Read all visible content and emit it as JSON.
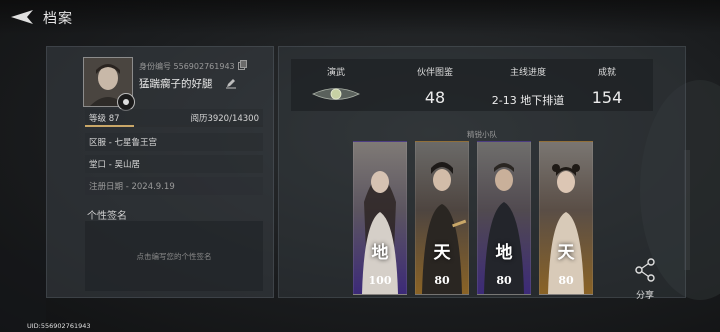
{
  "header": {
    "title": "档案"
  },
  "profile": {
    "id_label": "身份编号 556902761943",
    "nickname": "猛踹瘸子的好腿",
    "level": "等级 87",
    "experience": "阅历3920/14300",
    "experience_progress": 0.274,
    "server": "区服 - 七星鲁王宫",
    "hall": "堂口 - 吴山居",
    "register_date": "注册日期 - 2024.9.19",
    "signature_title": "个性签名",
    "signature_placeholder": "点击编写您的个性签名"
  },
  "stats": {
    "martial": {
      "label": "演武"
    },
    "companions": {
      "label": "伙伴图鉴",
      "value": "48"
    },
    "mainline": {
      "label": "主线进度",
      "value": "2-13 地下排道"
    },
    "achievements": {
      "label": "成就",
      "value": "154"
    }
  },
  "squad": {
    "label": "精锐小队",
    "members": [
      {
        "rank": "地",
        "level": "100"
      },
      {
        "rank": "天",
        "level": "80"
      },
      {
        "rank": "地",
        "level": "80"
      },
      {
        "rank": "天",
        "level": "80"
      }
    ]
  },
  "share": {
    "label": "分享"
  },
  "footer": {
    "uid": "UID:556902761943"
  },
  "colors": {
    "accent_gold": "#c9a768",
    "rank_purple": "#5b3f9e",
    "rank_gold": "#b8862e"
  },
  "icons": [
    "back-arrow-icon",
    "copy-icon",
    "edit-icon",
    "martial-badge-icon",
    "share-icon",
    "avatar-frame-badge-icon"
  ]
}
